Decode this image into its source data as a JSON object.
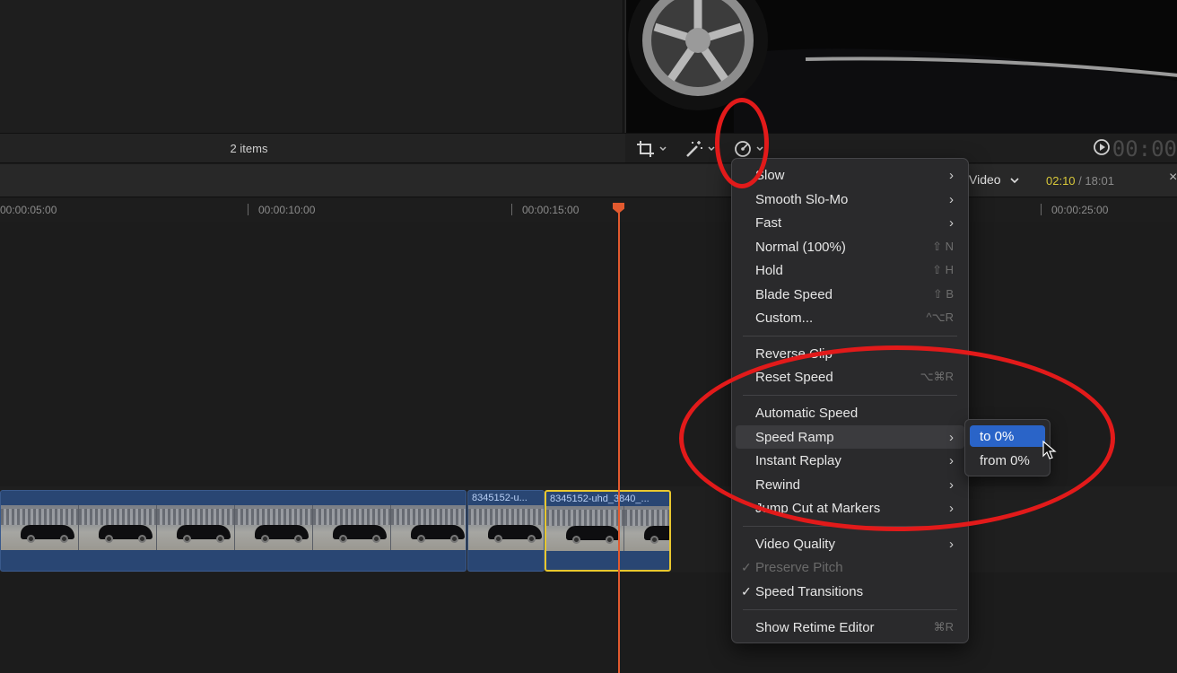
{
  "browser": {
    "items_count": "2 items"
  },
  "viewer": {
    "timecode": "00:00"
  },
  "timeline_header": {
    "video_menu": "Video",
    "current_time": "02:10",
    "separator": " / ",
    "total_time": "18:01"
  },
  "ruler": {
    "labels": [
      "00:00:05:00",
      "00:00:10:00",
      "00:00:15:00",
      "00:00:25:00"
    ]
  },
  "clips": [
    {
      "label": ""
    },
    {
      "label": "8345152-u..."
    },
    {
      "label": "8345152-uhd_3840_..."
    }
  ],
  "speed_menu": {
    "items": [
      {
        "label": "Slow",
        "shortcut": "",
        "submenu": true
      },
      {
        "label": "Smooth Slo-Mo",
        "shortcut": "",
        "submenu": true
      },
      {
        "label": "Fast",
        "shortcut": "",
        "submenu": true
      },
      {
        "label": "Normal (100%)",
        "shortcut": "⇧ N"
      },
      {
        "label": "Hold",
        "shortcut": "⇧ H"
      },
      {
        "label": "Blade Speed",
        "shortcut": "⇧ B"
      },
      {
        "label": "Custom...",
        "shortcut": "^⌥R"
      },
      {
        "label": "Reverse Clip",
        "shortcut": ""
      },
      {
        "label": "Reset Speed",
        "shortcut": "⌥⌘R"
      },
      {
        "label": "Automatic Speed",
        "shortcut": ""
      },
      {
        "label": "Speed Ramp",
        "shortcut": "",
        "submenu": true
      },
      {
        "label": "Instant Replay",
        "shortcut": "",
        "submenu": true
      },
      {
        "label": "Rewind",
        "shortcut": "",
        "submenu": true
      },
      {
        "label": "Jump Cut at Markers",
        "shortcut": "",
        "submenu": true
      },
      {
        "label": "Video Quality",
        "shortcut": "",
        "submenu": true
      },
      {
        "label": "Preserve Pitch",
        "checked": true,
        "disabled": true
      },
      {
        "label": "Speed Transitions",
        "checked": true
      },
      {
        "label": "Show Retime Editor",
        "shortcut": "⌘R"
      }
    ],
    "submenu_arrow": "›",
    "check_mark": "✓"
  },
  "speed_ramp_submenu": {
    "items": [
      "to 0%",
      "from 0%"
    ],
    "selected": "to 0%"
  },
  "colors": {
    "annotation_red": "#e21a1a",
    "playhead": "#e25a2f",
    "selection_blue": "#2a64c8",
    "clip_selected_border": "#e8c72e"
  },
  "icons": [
    "crop-icon",
    "magic-wand-icon",
    "speedometer-icon",
    "play-circle-icon",
    "chevron-down-icon",
    "mouse-cursor-icon"
  ]
}
